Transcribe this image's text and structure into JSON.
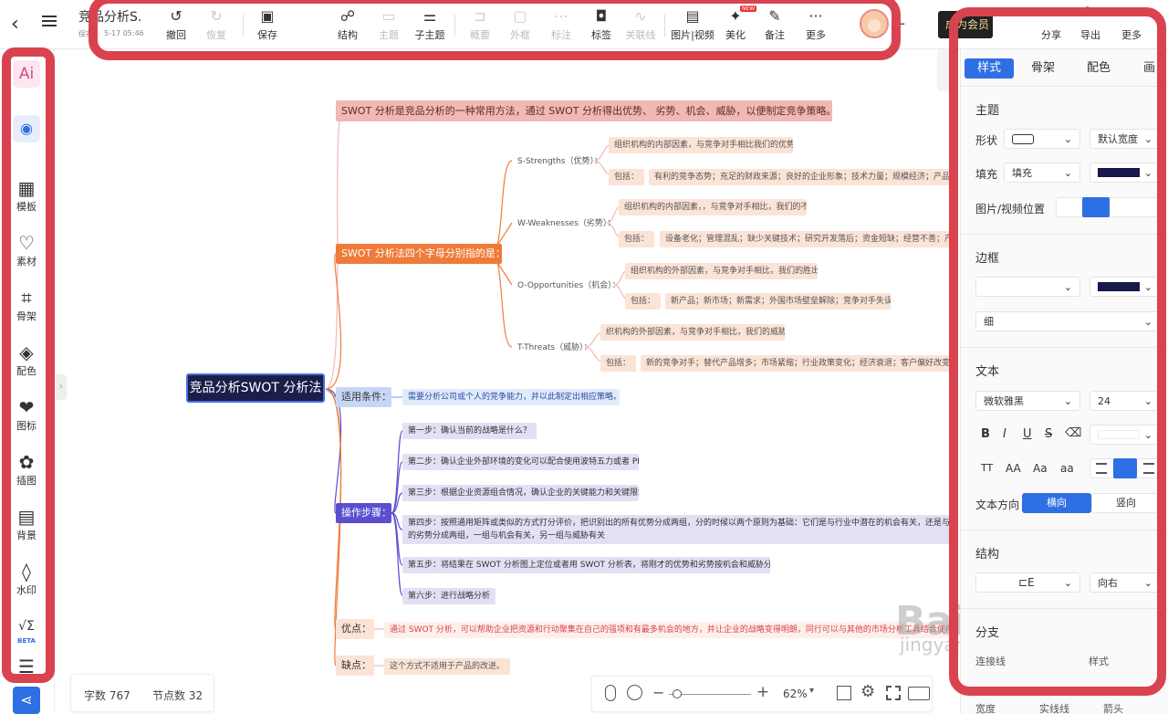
{
  "header": {
    "back_icon": "chevron-left-icon",
    "menu_icon": "hamburger-icon",
    "doc_title": "竞品分析S...",
    "save_status": "保存",
    "date": "5-17 05:46"
  },
  "toolbar": [
    {
      "label": "撤回",
      "icon": "undo-icon",
      "enabled": true
    },
    {
      "label": "恢复",
      "icon": "redo-icon",
      "enabled": false
    },
    {
      "label": "保存",
      "icon": "save-icon",
      "enabled": true
    },
    {
      "label": "结构",
      "icon": "structure-icon",
      "enabled": true
    },
    {
      "label": "主题",
      "icon": "topic-icon",
      "enabled": false
    },
    {
      "label": "子主题",
      "icon": "subtopic-icon",
      "enabled": true
    },
    {
      "label": "概要",
      "icon": "summary-icon",
      "enabled": false
    },
    {
      "label": "外框",
      "icon": "boundary-icon",
      "enabled": false
    },
    {
      "label": "标注",
      "icon": "callout-icon",
      "enabled": false
    },
    {
      "label": "标签",
      "icon": "tag-icon",
      "enabled": true
    },
    {
      "label": "关联线",
      "icon": "relation-line-icon",
      "enabled": false
    },
    {
      "label": "图片|视频",
      "icon": "media-icon",
      "enabled": true
    },
    {
      "label": "美化",
      "icon": "beautify-icon",
      "enabled": true,
      "badge": "NEW"
    },
    {
      "label": "备注",
      "icon": "note-icon",
      "enabled": true
    },
    {
      "label": "更多",
      "icon": "more-icon",
      "enabled": true
    }
  ],
  "topright": {
    "vip_label": "成为会员",
    "share_label": "分享",
    "export_label": "导出",
    "more_label": "更多",
    "plus_icon": "plus-icon",
    "avatar_icon": "avatar-icon"
  },
  "sidebar": [
    {
      "label": "",
      "icon": "ai-icon",
      "text": "Ai"
    },
    {
      "label": "",
      "icon": "robot-icon"
    },
    {
      "label": "模板",
      "icon": "template-icon"
    },
    {
      "label": "素材",
      "icon": "material-icon"
    },
    {
      "label": "骨架",
      "icon": "skeleton-icon"
    },
    {
      "label": "配色",
      "icon": "paint-bucket-icon"
    },
    {
      "label": "图标",
      "icon": "heart-icon"
    },
    {
      "label": "插图",
      "icon": "palette-icon"
    },
    {
      "label": "背景",
      "icon": "background-icon"
    },
    {
      "label": "水印",
      "icon": "droplet-icon"
    },
    {
      "label": "BETA",
      "icon": "formula-icon",
      "text": "√Σ"
    },
    {
      "label": "",
      "icon": "list-icon"
    }
  ],
  "mindmap": {
    "root": "竞品分析SWOT 分析法",
    "b1": "SWOT 分析是竞品分析的一种常用方法，通过 SWOT 分析得出优势、 劣势、机会、威胁，以便制定竞争策略。",
    "b2": "SWOT 分析法四个字母分别指的是：",
    "s_title": "S-Strengths（优势）：",
    "s_def": "组织机构的内部因素，与竞争对手相比我们的优势",
    "s_inc": "包括：",
    "s_items": "有利的竞争态势；充足的财政来源；良好的企业形象；技术力量；规模经济；产品质量；市场份",
    "w_title": "W-Weaknesses（劣势）：",
    "w_def": "组织机构的内部因素，，与竞争对手相比，我们的不足",
    "w_inc": "包括：",
    "w_items": "设备老化；管理混乱；缺少关键技术；研究开发落后；资金短缺；经营不善；产品积压；竞",
    "o_title": "O-Opportunities（机会）：",
    "o_def": "组织机构的外部因素，与竞争对手相比，我们的胜出机会",
    "o_inc": "包括：",
    "o_items": "新产品；新市场；新需求；外国市场壁垒解除；竞争对手失误等",
    "t_title": "T-Threats（威胁）：",
    "t_def": "织机构的外部因素，与竞争对手相比，我们的威胁",
    "t_inc": "包括：",
    "t_items": "新的竞争对手；替代产品增多；市场紧缩；行业政策变化；经济衰退；客户偏好改变；突发事件等",
    "b3": "适用条件：",
    "b3_child": "需要分析公司或个人的竞争能力，并以此制定出相应策略。",
    "b4": "操作步骤：",
    "step1": "第一步：确认当前的战略是什么？",
    "step2": "第二步：确认企业外部环境的变化可以配合使用波特五力或者 PEST",
    "step3": "第三步：根据企业资源组合情况，确认企业的关键能力和关键限制",
    "step4a": "第四步：按照通用矩阵或类似的方式打分评价，把识别出的所有优势分成两组，分的时候以两个原则为基础：它们是与行业中潜在的机会有关，还是与潜在的威胁有关。用同样",
    "step4b": "的劣势分成两组，一组与机会有关，另一组与威胁有关",
    "step5": "第五步：将结果在 SWOT 分析图上定位或者用 SWOT 分析表，将刚才的优势和劣势按机会和威胁分别填入表格。",
    "step6": "第六步：进行战略分析",
    "b5": "优点：",
    "b5_child": "通过 SWOT 分析，可以帮助企业把资源和行动聚集在自己的强项和有最多机会的地方，并让企业的战略变得明朗，同行可以与其他的市场分析工具结合使用。",
    "b6": "缺点：",
    "b6_child": "这个方式不适用于产品的改进。"
  },
  "bottombar": {
    "word_count": "字数 767",
    "node_count": "节点数 32",
    "zoom": "62%",
    "mouse_icon": "mouse-icon",
    "locate_icon": "crosshair-icon",
    "minus_icon": "minus-icon",
    "plus_icon": "plus-icon",
    "fit_icon": "fit-screen-icon",
    "settings_icon": "gear-icon",
    "fullscreen_icon": "fullscreen-icon",
    "keyboard_icon": "keyboard-icon"
  },
  "panel": {
    "tabs": [
      "样式",
      "骨架",
      "配色",
      "画布"
    ],
    "sec_topic": "主题",
    "shape_label": "形状",
    "shape_width": "默认宽度",
    "fill_label": "填充",
    "fill_value": "填充",
    "fill_color": "#16194a",
    "media_pos_label": "图片/视频位置",
    "sec_border": "边框",
    "border_color": "#16194a",
    "border_weight": "细",
    "sec_text": "文本",
    "font_name": "微软雅黑",
    "font_size": "24",
    "case_opts": [
      "TT",
      "AA",
      "Aa",
      "aa"
    ],
    "text_dir_label": "文本方向",
    "dir_h": "横向",
    "dir_v": "竖向",
    "sec_struct": "结构",
    "struct_dir": "向右",
    "sec_branch": "分支",
    "conn_label": "连接线",
    "style_label": "样式",
    "width_label": "宽度",
    "solid_label": "实线线",
    "arrow_label": "箭头"
  },
  "watermark": {
    "text": "Bai du 经验",
    "sub": "jingyan.baidu.com"
  },
  "colors": {
    "highlight": "#d9434f",
    "orange": "#ef7b3a",
    "navy": "#1b1e4b",
    "purple": "#5a4fcf",
    "pinknode": "#f2b8b3",
    "blue": "#2f6fe4"
  }
}
